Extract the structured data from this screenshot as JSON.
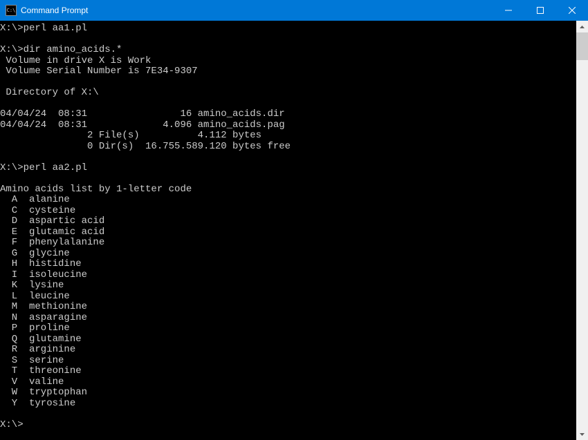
{
  "window": {
    "title": "Command Prompt",
    "icon_text": "C:\\"
  },
  "terminal": {
    "lines": [
      "X:\\>perl aa1.pl",
      "",
      "X:\\>dir amino_acids.*",
      " Volume in drive X is Work",
      " Volume Serial Number is 7E34-9307",
      "",
      " Directory of X:\\",
      "",
      "04/04/24  08:31                16 amino_acids.dir",
      "04/04/24  08:31             4.096 amino_acids.pag",
      "               2 File(s)          4.112 bytes",
      "               0 Dir(s)  16.755.589.120 bytes free",
      "",
      "X:\\>perl aa2.pl",
      "",
      "Amino acids list by 1-letter code",
      "  A  alanine",
      "  C  cysteine",
      "  D  aspartic acid",
      "  E  glutamic acid",
      "  F  phenylalanine",
      "  G  glycine",
      "  H  histidine",
      "  I  isoleucine",
      "  K  lysine",
      "  L  leucine",
      "  M  methionine",
      "  N  asparagine",
      "  P  proline",
      "  Q  glutamine",
      "  R  arginine",
      "  S  serine",
      "  T  threonine",
      "  V  valine",
      "  W  tryptophan",
      "  Y  tyrosine",
      "",
      "X:\\>"
    ]
  }
}
